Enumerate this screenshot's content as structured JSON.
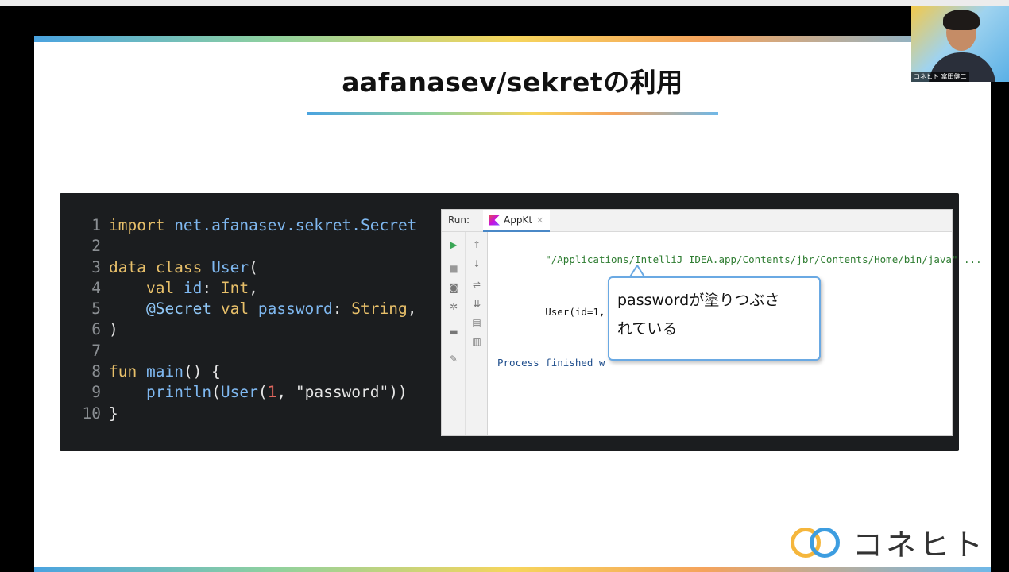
{
  "slide": {
    "title": "aafanasev/sekretの利用"
  },
  "code": {
    "lines": [
      {
        "n": "1",
        "parts": [
          [
            "kw",
            "import "
          ],
          [
            "fn",
            "net.afanasev.sekret.Secret"
          ]
        ]
      },
      {
        "n": "2",
        "parts": []
      },
      {
        "n": "3",
        "parts": [
          [
            "kw",
            "data class "
          ],
          [
            "typ",
            "User"
          ],
          [
            "str",
            "("
          ]
        ]
      },
      {
        "n": "4",
        "parts": [
          [
            "str",
            "    "
          ],
          [
            "kw",
            "val "
          ],
          [
            "fn",
            "id"
          ],
          [
            "str",
            ": "
          ],
          [
            "kw",
            "Int"
          ],
          [
            "str",
            ","
          ]
        ]
      },
      {
        "n": "5",
        "parts": [
          [
            "str",
            "    "
          ],
          [
            "ann",
            "@Secret "
          ],
          [
            "kw",
            "val "
          ],
          [
            "fn",
            "password"
          ],
          [
            "str",
            ": "
          ],
          [
            "kw",
            "String"
          ],
          [
            "str",
            ","
          ]
        ]
      },
      {
        "n": "6",
        "parts": [
          [
            "str",
            ")"
          ]
        ]
      },
      {
        "n": "7",
        "parts": []
      },
      {
        "n": "8",
        "parts": [
          [
            "kw",
            "fun "
          ],
          [
            "fn",
            "main"
          ],
          [
            "str",
            "() {"
          ]
        ]
      },
      {
        "n": "9",
        "parts": [
          [
            "str",
            "    "
          ],
          [
            "fn",
            "println"
          ],
          [
            "str",
            "("
          ],
          [
            "typ",
            "User"
          ],
          [
            "str",
            "("
          ],
          [
            "num",
            "1"
          ],
          [
            "str",
            ", \"password\"))"
          ]
        ]
      },
      {
        "n": "10",
        "parts": [
          [
            "str",
            "}"
          ]
        ]
      }
    ]
  },
  "ide": {
    "run_label": "Run:",
    "tab_label": "AppKt",
    "console_path": "\"/Applications/IntelliJ IDEA.app/Contents/jbr/Contents/Home/bin/java\" ...",
    "console_output_prefix": "User(id=1, password=",
    "console_output_suffix": ")",
    "console_process": "Process finished w"
  },
  "callout": {
    "text_line1": "passwordが塗りつぶさ",
    "text_line2": "れている"
  },
  "avatar": {
    "name": "コネヒト 富田健二"
  },
  "logo": {
    "text": "コネヒト"
  },
  "colors": {
    "accent_blue": "#4aa3e0",
    "accent_yellow": "#f6d55c",
    "code_bg": "#1b1d1f"
  }
}
